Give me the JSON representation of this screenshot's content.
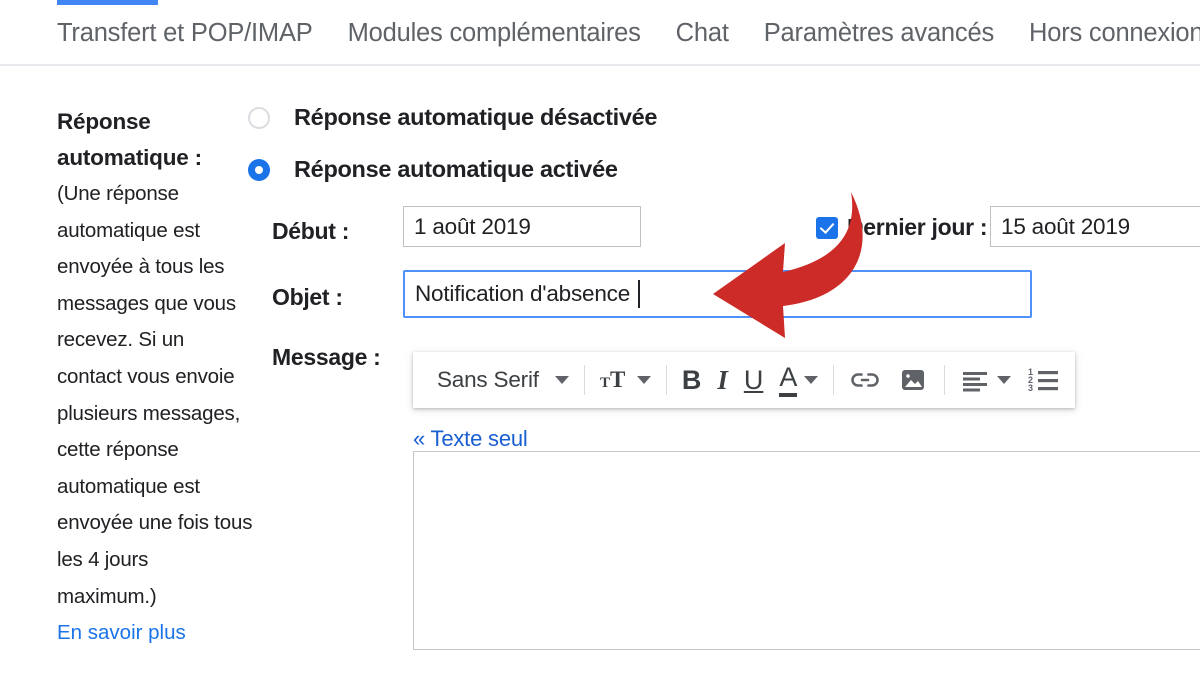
{
  "tabs": {
    "items": [
      {
        "label": "Transfert et POP/IMAP"
      },
      {
        "label": "Modules complémentaires"
      },
      {
        "label": "Chat"
      },
      {
        "label": "Paramètres avancés"
      },
      {
        "label": "Hors connexion"
      }
    ],
    "active_indicator_color": "#4285f4"
  },
  "sidebar": {
    "title": "Réponse automatique :",
    "note": "(Une réponse automatique est envoyée à tous les messages que vous recevez. Si un contact vous envoie plusieurs messages, cette réponse automatique est envoyée une fois tous les 4 jours maximum.)",
    "link": "En savoir plus"
  },
  "form": {
    "radio_off": {
      "label": "Réponse automatique désactivée",
      "selected": "false"
    },
    "radio_on": {
      "label": "Réponse automatique activée",
      "selected": "true"
    },
    "debut": {
      "label": "Début :",
      "value": "1 août 2019"
    },
    "dernier_jour": {
      "label": "Dernier jour :",
      "value": "15 août 2019",
      "checked": "true"
    },
    "objet": {
      "label": "Objet :",
      "value": "Notification d'absence "
    },
    "message": {
      "label": "Message :",
      "value": ""
    },
    "accent_color": "#1a73e8",
    "focus_border_color": "#4d90fe"
  },
  "toolbar": {
    "font_name": "Sans Serif",
    "items": [
      {
        "name": "font-family-select",
        "label": "Sans Serif"
      },
      {
        "name": "font-size-button",
        "label": "T"
      },
      {
        "name": "bold-button",
        "label": "B"
      },
      {
        "name": "italic-button",
        "label": "I"
      },
      {
        "name": "underline-button",
        "label": "U"
      },
      {
        "name": "text-color-button",
        "label": "A"
      },
      {
        "name": "insert-link-button",
        "label": ""
      },
      {
        "name": "insert-image-button",
        "label": ""
      },
      {
        "name": "align-button",
        "label": ""
      },
      {
        "name": "numbered-list-button",
        "label": ""
      }
    ]
  },
  "editor": {
    "plain_text_link": "« Texte seul",
    "link_color": "#1a5fd0"
  },
  "annotation": {
    "arrow_color": "#cc2b28",
    "points_to": "objet-input"
  }
}
